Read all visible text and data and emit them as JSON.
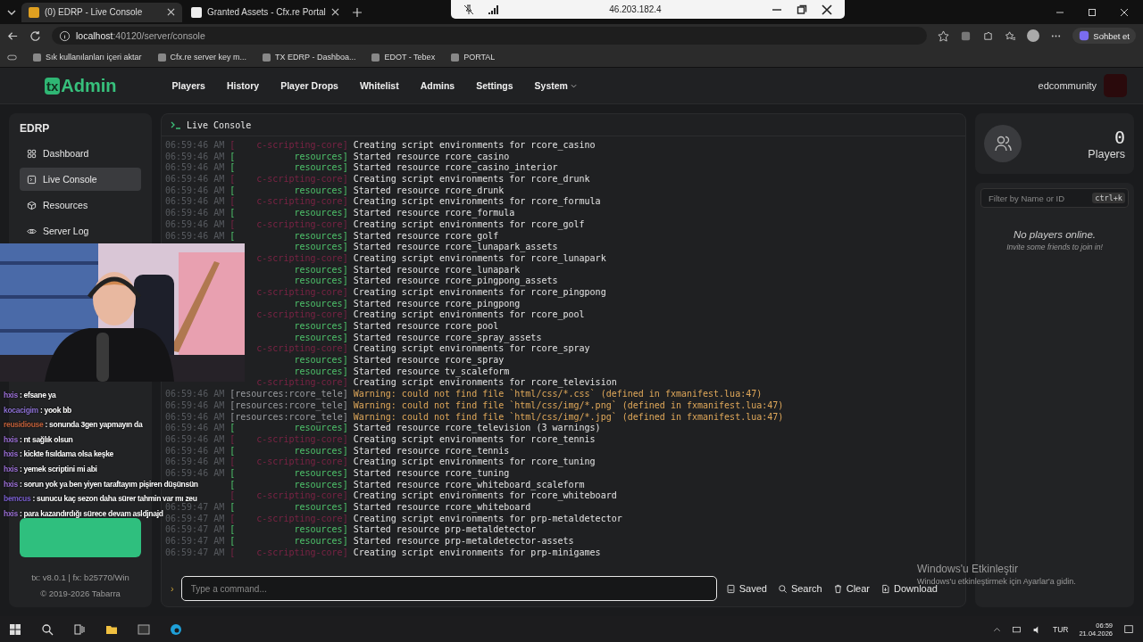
{
  "browser": {
    "tabs": [
      {
        "title": "(0) EDRP - Live Console",
        "selected": true
      },
      {
        "title": "Granted Assets - Cfx.re Portal",
        "selected": false
      }
    ],
    "url_host": "localhost",
    "url_path": ":40120/server/console",
    "profile_button": "Sohbet et",
    "bookmarks": [
      "Sık kullanılanları içeri aktar",
      "Cfx.re server key m...",
      "TX EDRP - Dashboa...",
      "EDOT - Tebex",
      "PORTAL"
    ]
  },
  "remote_bar": {
    "address": "46.203.182.4"
  },
  "app": {
    "logo_tx": "tx",
    "logo_text": "Admin",
    "nav": [
      {
        "label": "Players",
        "kind": "link"
      },
      {
        "label": "History",
        "kind": "link"
      },
      {
        "label": "Player Drops",
        "kind": "link"
      },
      {
        "label": "Whitelist",
        "kind": "link"
      },
      {
        "label": "Admins",
        "kind": "link"
      },
      {
        "label": "Settings",
        "kind": "link"
      },
      {
        "label": "System",
        "kind": "menu"
      }
    ],
    "user": "edcommunity"
  },
  "sidebar": {
    "server": "EDRP",
    "items": [
      {
        "label": "Dashboard",
        "selected": false
      },
      {
        "label": "Live Console",
        "selected": true
      },
      {
        "label": "Resources",
        "selected": false
      },
      {
        "label": "Server Log",
        "selected": false
      }
    ],
    "version": "tx: v8.0.1 | fx: b25770/Win",
    "copyright": "© 2019-2026 Tabarra"
  },
  "console": {
    "title": "Live Console",
    "lines": [
      {
        "kind": "script",
        "time": "06:59:46 AM",
        "open": "[",
        "tag": "c-scripting-core]",
        "message": "Creating script environments for rcore_casino"
      },
      {
        "kind": "info",
        "time": "06:59:46 AM",
        "open": "[",
        "tag": "resources]",
        "message": "Started resource rcore_casino"
      },
      {
        "kind": "info",
        "time": "06:59:46 AM",
        "open": "[",
        "tag": "resources]",
        "message": "Started resource rcore_casino_interior"
      },
      {
        "kind": "script",
        "time": "06:59:46 AM",
        "open": "[",
        "tag": "c-scripting-core]",
        "message": "Creating script environments for rcore_drunk"
      },
      {
        "kind": "info",
        "time": "06:59:46 AM",
        "open": "[",
        "tag": "resources]",
        "message": "Started resource rcore_drunk"
      },
      {
        "kind": "script",
        "time": "06:59:46 AM",
        "open": "[",
        "tag": "c-scripting-core]",
        "message": "Creating script environments for rcore_formula"
      },
      {
        "kind": "info",
        "time": "06:59:46 AM",
        "open": "[",
        "tag": "resources]",
        "message": "Started resource rcore_formula"
      },
      {
        "kind": "script",
        "time": "06:59:46 AM",
        "open": "[",
        "tag": "c-scripting-core]",
        "message": "Creating script environments for rcore_golf"
      },
      {
        "kind": "info",
        "time": "06:59:46 AM",
        "open": "[",
        "tag": "resources]",
        "message": "Started resource rcore_golf"
      },
      {
        "kind": "info",
        "tag": "resources]",
        "message": "Started resource rcore_lunapark_assets"
      },
      {
        "kind": "script",
        "tag": "c-scripting-core]",
        "message": "Creating script environments for rcore_lunapark"
      },
      {
        "kind": "info",
        "tag": "resources]",
        "message": "Started resource rcore_lunapark"
      },
      {
        "kind": "info",
        "tag": "resources]",
        "message": "Started resource rcore_pingpong_assets"
      },
      {
        "kind": "script",
        "tag": "c-scripting-core]",
        "message": "Creating script environments for rcore_pingpong"
      },
      {
        "kind": "info",
        "tag": "resources]",
        "message": "Started resource rcore_pingpong"
      },
      {
        "kind": "script",
        "tag": "c-scripting-core]",
        "message": "Creating script environments for rcore_pool"
      },
      {
        "kind": "info",
        "tag": "resources]",
        "message": "Started resource rcore_pool"
      },
      {
        "kind": "info",
        "tag": "resources]",
        "message": "Started resource rcore_spray_assets"
      },
      {
        "kind": "script",
        "tag": "c-scripting-core]",
        "message": "Creating script environments for rcore_spray"
      },
      {
        "kind": "info",
        "tag": "resources]",
        "message": "Started resource rcore_spray"
      },
      {
        "kind": "info",
        "tag": "resources]",
        "message": "Started resource tv_scaleform"
      },
      {
        "kind": "script",
        "tag": "c-scripting-core]",
        "message": "Creating script environments for rcore_television"
      },
      {
        "kind": "warning",
        "time": "06:59:46 AM",
        "open": "[",
        "tag": "resources:rcore_tele]",
        "message": "Warning: could not find file `html/css/*.css` (defined in fxmanifest.lua:47)"
      },
      {
        "kind": "warning",
        "time": "06:59:46 AM",
        "open": "[",
        "tag": "resources:rcore_tele]",
        "message": "Warning: could not find file `html/css/img/*.png` (defined in fxmanifest.lua:47)"
      },
      {
        "kind": "warning",
        "time": "06:59:46 AM",
        "open": "[",
        "tag": "resources:rcore_tele]",
        "message": "Warning: could not find file `html/css/img/*.jpg` (defined in fxmanifest.lua:47)"
      },
      {
        "kind": "info",
        "time": "06:59:46 AM",
        "open": "[",
        "tag": "resources]",
        "message": "Started resource rcore_television (3 warnings)"
      },
      {
        "kind": "script",
        "time": "06:59:46 AM",
        "open": "[",
        "tag": "c-scripting-core]",
        "message": "Creating script environments for rcore_tennis"
      },
      {
        "kind": "info",
        "time": "06:59:46 AM",
        "open": "[",
        "tag": "resources]",
        "message": "Started resource rcore_tennis"
      },
      {
        "kind": "script",
        "time": "06:59:46 AM",
        "open": "[",
        "tag": "c-scripting-core]",
        "message": "Creating script environments for rcore_tuning"
      },
      {
        "kind": "info",
        "time": "06:59:46 AM",
        "open": "[",
        "tag": "resources]",
        "message": "Started resource rcore_tuning"
      },
      {
        "kind": "info",
        "open": "[",
        "tag": "resources]",
        "message": "Started resource rcore_whiteboard_scaleform"
      },
      {
        "kind": "script",
        "open": "[",
        "tag": "c-scripting-core]",
        "message": "Creating script environments for rcore_whiteboard"
      },
      {
        "kind": "info",
        "time": "06:59:47 AM",
        "open": "[",
        "tag": "resources]",
        "message": "Started resource rcore_whiteboard"
      },
      {
        "kind": "script",
        "time": "06:59:47 AM",
        "open": "[",
        "tag": "c-scripting-core]",
        "message": "Creating script environments for prp-metaldetector"
      },
      {
        "kind": "info",
        "time": "06:59:47 AM",
        "open": "[",
        "tag": "resources]",
        "message": "Started resource prp-metaldetector"
      },
      {
        "kind": "info",
        "time": "06:59:47 AM",
        "open": "[",
        "tag": "resources]",
        "message": "Started resource prp-metaldetector-assets"
      },
      {
        "kind": "script",
        "time": "06:59:47 AM",
        "open": "[",
        "tag": "c-scripting-core]",
        "message": "Creating script environments for prp-minigames"
      }
    ],
    "prompt": "›",
    "placeholder": "Type a command...",
    "actions": [
      "Saved",
      "Search",
      "Clear",
      "Download"
    ]
  },
  "players": {
    "count": "0",
    "label": "Players",
    "filter_placeholder": "Filter by Name or ID",
    "shortcut": "ctrl+k",
    "empty_title": "No players online.",
    "empty_hint": "Invite some friends to join in!"
  },
  "chat": [
    {
      "user": "hxis",
      "color": "#9b6fd6",
      "message": ": efsane ya"
    },
    {
      "user": "kocacigim",
      "color": "#8a6fd0",
      "message": ": yook bb"
    },
    {
      "user": "reusidiouse",
      "color": "#c0603a",
      "message": ": sonunda 3gen yapmayın da"
    },
    {
      "user": "hxis",
      "color": "#9b6fd6",
      "message": ": nt sağlık olsun"
    },
    {
      "user": "hxis",
      "color": "#9b6fd6",
      "message": ": kickte fısıldama olsa keşke"
    },
    {
      "user": "hxis",
      "color": "#9b6fd6",
      "message": ": yemek scriptini mi abi"
    },
    {
      "user": "hxis",
      "color": "#9b6fd6",
      "message": ": sorun yok ya ben yiyen taraftayım pişiren düşünsün"
    },
    {
      "user": "bemcus",
      "color": "#7a5fd0",
      "message": ": sunucu kaç sezon daha sürer tahmin var mı zeu"
    },
    {
      "user": "hxis",
      "color": "#9b6fd6",
      "message": ": para kazandırdığı sürece devam asldjnajd"
    }
  ],
  "watermark": {
    "title": "Windows'u Etkinleştir",
    "hint": "Windows'u etkinleştirmek için Ayarlar'a gidin."
  },
  "taskbar": {
    "language": "TUR",
    "time": "06:59",
    "date": "21.04.2026"
  }
}
